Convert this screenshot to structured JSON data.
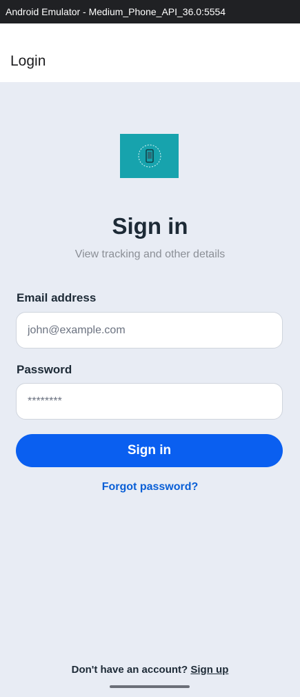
{
  "window": {
    "title": "Android Emulator - Medium_Phone_API_36.0:5554"
  },
  "appbar": {
    "title": "Login"
  },
  "logo": {
    "icon": "phone-logo-icon",
    "background": "#17a3ad"
  },
  "main": {
    "heading": "Sign in",
    "subheading": "View tracking and other details",
    "email": {
      "label": "Email address",
      "placeholder": "john@example.com",
      "value": ""
    },
    "password": {
      "label": "Password",
      "placeholder": "********",
      "value": ""
    },
    "sign_in_button": "Sign in",
    "forgot_password": "Forgot password?"
  },
  "footer": {
    "prompt": "Don't have an account?",
    "signup_link": "Sign up"
  },
  "colors": {
    "accent": "#0a5ff0",
    "link": "#0a5fd6",
    "background": "#e8ecf4"
  }
}
